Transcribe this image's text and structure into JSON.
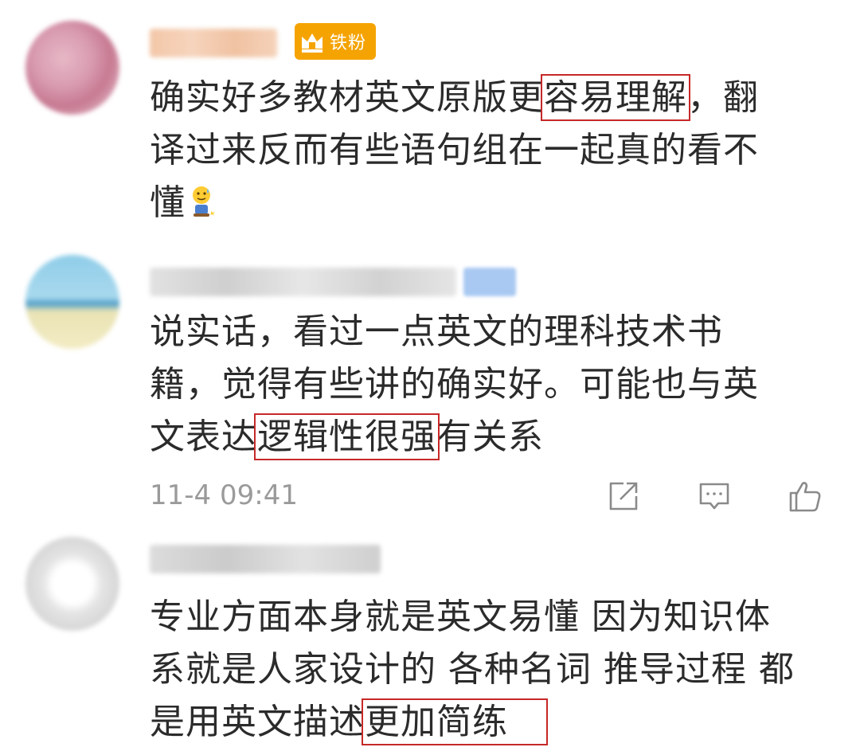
{
  "comments": [
    {
      "avatar": "avatar-blurred-pink",
      "username_visible": false,
      "badge": {
        "icon": "crown-icon",
        "label": "铁粉",
        "color": "#f5a300"
      },
      "lines": [
        [
          "确实好多教材英文原版更",
          "容易理解",
          "，翻"
        ],
        [
          "译过来反而有些语句组在一起真的看不"
        ],
        [
          "懂"
        ]
      ],
      "highlight": "容易理解",
      "emoji": "sweat-smile-emoji"
    },
    {
      "avatar": "avatar-blurred-beach",
      "username_visible": false,
      "lines": [
        [
          "说实话，看过一点英文的理科技术书"
        ],
        [
          "籍，觉得有些讲的确实好。可能也与英"
        ],
        [
          "文表达",
          "逻辑性很强",
          "有关系"
        ]
      ],
      "highlight": "逻辑性很强",
      "timestamp": "11-4 09:41",
      "actions": [
        "share-icon",
        "comment-icon",
        "like-icon"
      ]
    },
    {
      "avatar": "avatar-blurred-white",
      "username_visible": false,
      "lines": [
        [
          "专业方面本身就是英文易懂 因为知识体"
        ],
        [
          "系就是人家设计的 各种名词 推导过程 都"
        ],
        [
          "是用英文描述",
          "更加简练"
        ]
      ],
      "highlight": "更加简练"
    }
  ],
  "colors": {
    "highlight_border": "#c62828",
    "timestamp": "#9a9a9a",
    "icon": "#8a8a8a"
  }
}
